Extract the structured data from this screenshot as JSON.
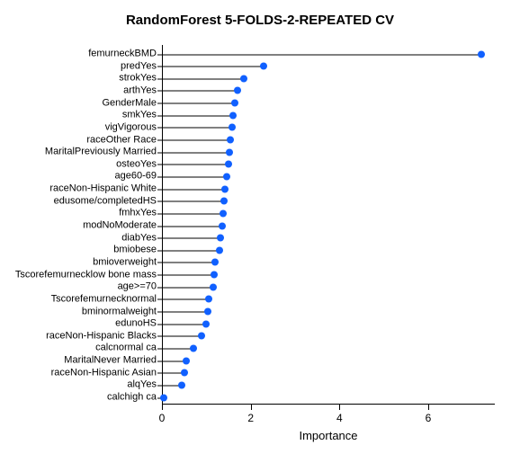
{
  "chart_data": {
    "type": "bar",
    "title": "RandomForest 5-FOLDS-2-REPEATED CV",
    "xlabel": "Importance",
    "ylabel": "",
    "xlim": [
      0,
      7.5
    ],
    "ticks": [
      0,
      2,
      4,
      6
    ],
    "categories": [
      "femurneckBMD",
      "predYes",
      "strokYes",
      "arthYes",
      "GenderMale",
      "smkYes",
      "vigVigorous",
      "raceOther Race",
      "MaritalPreviously Married",
      "osteoYes",
      "age60-69",
      "raceNon-Hispanic White",
      "edusome/completedHS",
      "fmhxYes",
      "modNoModerate",
      "diabYes",
      "bmiobese",
      "bmioverweight",
      "Tscorefemurnecklow bone mass",
      "age>=70",
      "Tscorefemurnecknormal",
      "bminormalweight",
      "edunoHS",
      "raceNon-Hispanic Blacks",
      "calcnormal ca",
      "MaritalNever Married",
      "raceNon-Hispanic Asian",
      "alqYes",
      "calchigh ca"
    ],
    "values": [
      7.2,
      2.3,
      1.85,
      1.7,
      1.65,
      1.6,
      1.58,
      1.55,
      1.52,
      1.5,
      1.45,
      1.42,
      1.4,
      1.38,
      1.35,
      1.32,
      1.3,
      1.2,
      1.18,
      1.15,
      1.05,
      1.03,
      1.0,
      0.9,
      0.7,
      0.55,
      0.5,
      0.45,
      0.05
    ]
  }
}
